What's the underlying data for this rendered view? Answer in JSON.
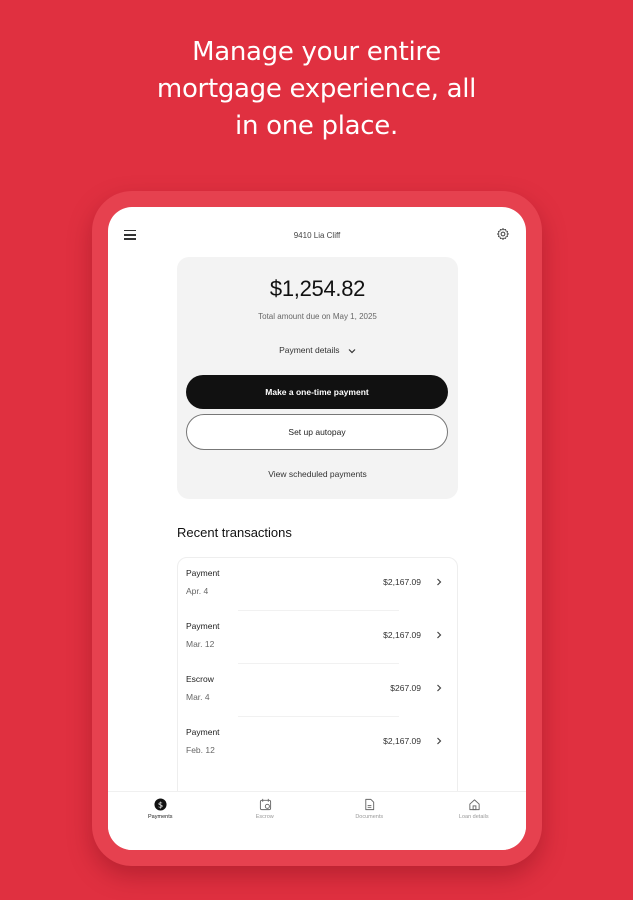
{
  "headline": {
    "line1": "Manage your entire",
    "line2": "mortgage experience, all",
    "line3": "in one place."
  },
  "app": {
    "loan_title": "9410 Lia Cliff",
    "icons": {
      "menu": "hamburger-menu-icon",
      "settings": "gear-icon"
    }
  },
  "payment_card": {
    "amount": "$1,254.82",
    "due_text": "Total amount due on May 1, 2025",
    "details_label": "Payment details",
    "primary_button": "Make a one-time payment",
    "secondary_button": "Set up autopay",
    "scheduled_link": "View scheduled payments"
  },
  "recent": {
    "heading": "Recent transactions",
    "transactions": [
      {
        "type": "Payment",
        "date": "Apr. 4",
        "amount": "$2,167.09"
      },
      {
        "type": "Payment",
        "date": "Mar. 12",
        "amount": "$2,167.09"
      },
      {
        "type": "Escrow",
        "date": "Mar. 4",
        "amount": "$267.09"
      },
      {
        "type": "Payment",
        "date": "Feb. 12",
        "amount": "$2,167.09"
      }
    ]
  },
  "bottom_nav": {
    "items": [
      {
        "label": "Payments",
        "icon": "dollar-circle-icon",
        "active": true
      },
      {
        "label": "Escrow",
        "icon": "escrow-icon",
        "active": false
      },
      {
        "label": "Documents",
        "icon": "document-icon",
        "active": false
      },
      {
        "label": "Loan details",
        "icon": "home-icon",
        "active": false
      }
    ]
  },
  "colors": {
    "background": "#e03040",
    "tablet_frame": "#e6414f",
    "primary_button": "#111111",
    "card_background": "#f3f3f3"
  }
}
